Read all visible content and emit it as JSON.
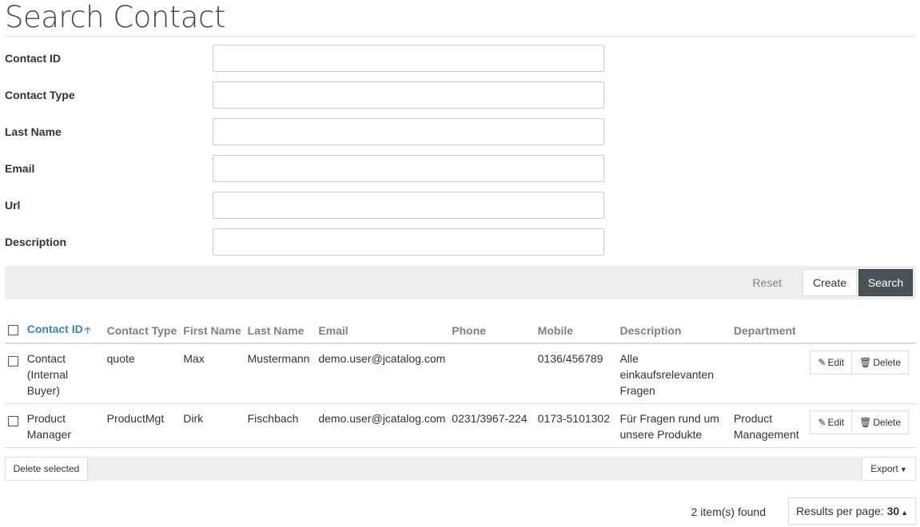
{
  "page": {
    "title": "Search Contact"
  },
  "form": {
    "fields": [
      {
        "label": "Contact ID",
        "value": "",
        "placeholder": ""
      },
      {
        "label": "Contact Type",
        "value": "",
        "placeholder": ""
      },
      {
        "label": "Last Name",
        "value": "",
        "placeholder": ""
      },
      {
        "label": "Email",
        "value": "",
        "placeholder": ""
      },
      {
        "label": "Url",
        "value": "",
        "placeholder": ""
      },
      {
        "label": "Description",
        "value": "",
        "placeholder": ""
      }
    ]
  },
  "actions": {
    "reset": "Reset",
    "create": "Create",
    "search": "Search"
  },
  "table": {
    "columns": [
      "Contact ID",
      "Contact Type",
      "First Name",
      "Last Name",
      "Email",
      "Phone",
      "Mobile",
      "Description",
      "Department"
    ],
    "sort_icon": "sort-up-arrow-icon",
    "rows": [
      {
        "contact_id": "Contact (Internal Buyer)",
        "contact_type": "quote",
        "first_name": "Max",
        "last_name": "Mustermann",
        "email": "demo.user@jcatalog.com",
        "phone": "",
        "mobile": "0136/456789",
        "description": "Alle einkaufsrelevanten Fragen",
        "department": ""
      },
      {
        "contact_id": "Product Manager",
        "contact_type": "ProductMgt",
        "first_name": "Dirk",
        "last_name": "Fischbach",
        "email": "demo.user@jcatalog.com",
        "phone": "0231/3967-224",
        "mobile": "0173-5101302",
        "description": "Für Fragen rund um unsere Produkte",
        "department": "Product Management"
      }
    ],
    "edit_label": "Edit",
    "delete_label": "Delete"
  },
  "footer": {
    "delete_selected": "Delete selected",
    "export": "Export",
    "found": "2 item(s) found",
    "per_page_label": "Results per page:",
    "per_page_value": "30"
  },
  "colors": {
    "link": "#3a83b8",
    "primary_button": "#4a5259",
    "bar_bg": "#eeeeee"
  }
}
